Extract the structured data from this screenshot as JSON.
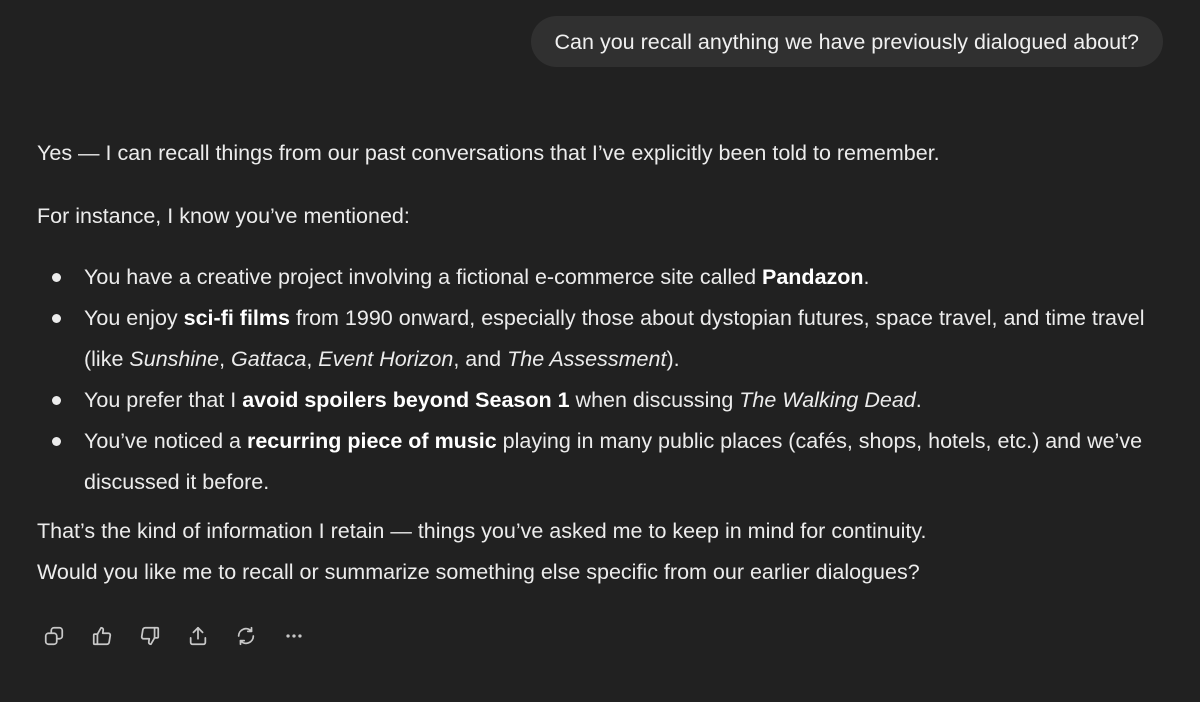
{
  "user_message": "Can you recall anything we have previously dialogued about?",
  "reply": {
    "intro": "Yes — I can recall things from our past conversations that I’ve explicitly been told to remember.",
    "lead": "For instance, I know you’ve mentioned:",
    "bullets": [
      {
        "a": "You have a creative project involving a fictional e-commerce site called ",
        "b": "Pandazon",
        "c": "."
      },
      {
        "a": "You enjoy ",
        "b": "sci-fi films",
        "c": " from 1990 onward, especially those about dystopian futures, space travel, and time travel (like ",
        "film1": "Sunshine",
        "sep1": ", ",
        "film2": "Gattaca",
        "sep2": ", ",
        "film3": "Event Horizon",
        "sep3": ", and ",
        "film4": "The Assessment",
        "end": ")."
      },
      {
        "a": "You prefer that I ",
        "b": "avoid spoilers beyond Season 1",
        "c": " when discussing ",
        "d": "The Walking Dead",
        "e": "."
      },
      {
        "a": "You’ve noticed a ",
        "b": "recurring piece of music",
        "c": " playing in many public places (cafés, shops, hotels, etc.) and we’ve discussed it before."
      }
    ],
    "closing_1": "That’s the kind of information I retain — things you’ve asked me to keep in mind for continuity.",
    "closing_2": "Would you like me to recall or summarize something else specific from our earlier dialogues?"
  },
  "actions": [
    {
      "icon": "copy-icon"
    },
    {
      "icon": "thumbs-up-icon"
    },
    {
      "icon": "thumbs-down-icon"
    },
    {
      "icon": "share-icon"
    },
    {
      "icon": "regenerate-icon"
    },
    {
      "icon": "more-icon"
    }
  ]
}
